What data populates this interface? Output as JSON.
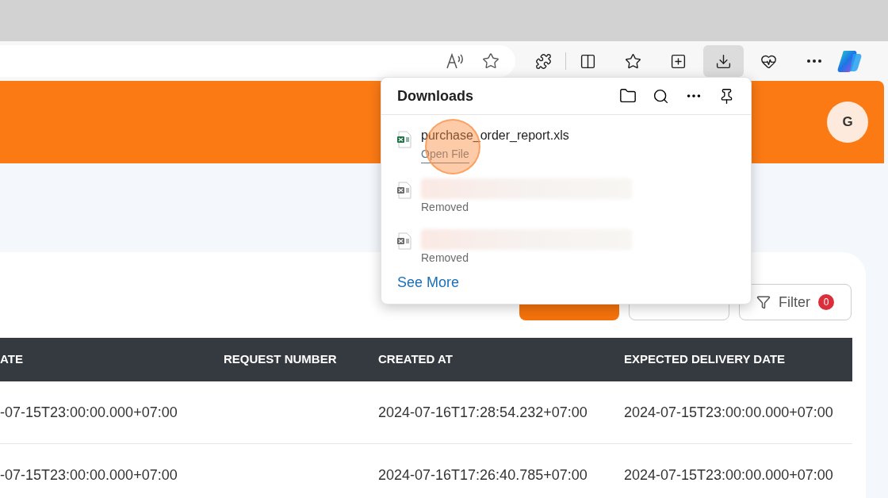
{
  "toolbar": {
    "downloads_open": true
  },
  "header": {
    "avatar": "G"
  },
  "actions": [
    {
      "kind": "primary"
    },
    {
      "kind": "outline"
    },
    {
      "kind": "filter",
      "label": "Filter",
      "badge": "0"
    }
  ],
  "table": {
    "columns": [
      "ATE",
      "REQUEST NUMBER",
      "CREATED AT",
      "EXPECTED DELIVERY DATE"
    ],
    "rows": [
      [
        "-07-15T23:00:00.000+07:00",
        "",
        "2024-07-16T17:28:54.232+07:00",
        "2024-07-15T23:00:00.000+07:00"
      ],
      [
        "-07-15T23:00:00.000+07:00",
        "",
        "2024-07-16T17:26:40.785+07:00",
        "2024-07-15T23:00:00.000+07:00"
      ]
    ]
  },
  "downloads": {
    "title": "Downloads",
    "items": [
      {
        "kind": "file",
        "name": "purchase_order_report.xls",
        "action": "Open File"
      },
      {
        "kind": "removed",
        "status": "Removed"
      },
      {
        "kind": "removed",
        "status": "Removed"
      }
    ],
    "see_more": "See More"
  },
  "click_marker": {
    "shown": true
  }
}
